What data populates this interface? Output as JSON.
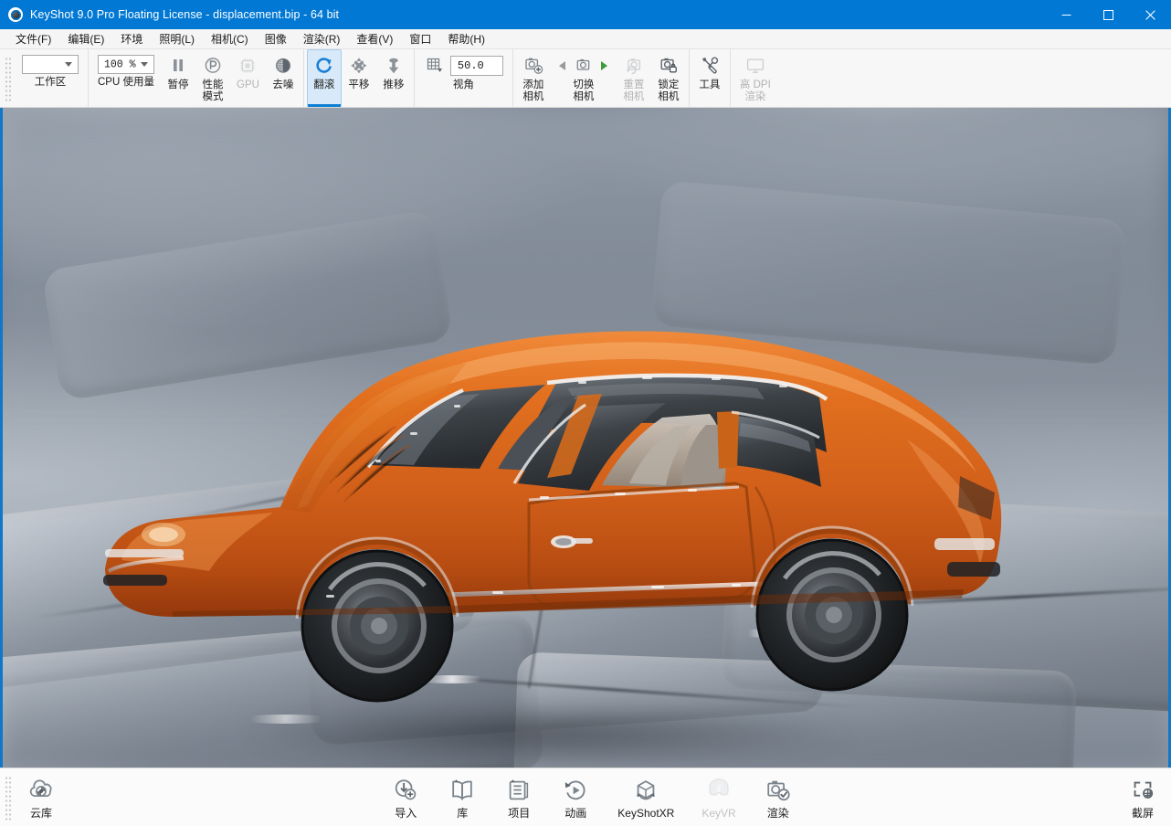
{
  "window": {
    "title": "KeyShot 9.0 Pro Floating License  - displacement.bip  - 64 bit",
    "app_name": "KeyShot 9.0 Pro Floating License",
    "document": "displacement.bip",
    "architecture": "64 bit",
    "accent_color": "#0078d4",
    "controls": {
      "minimize": "minimize-icon",
      "maximize": "maximize-icon",
      "close": "close-icon"
    }
  },
  "menubar": {
    "items": [
      {
        "label": "文件(F)"
      },
      {
        "label": "编辑(E)"
      },
      {
        "label": "环境"
      },
      {
        "label": "照明(L)"
      },
      {
        "label": "相机(C)"
      },
      {
        "label": "图像"
      },
      {
        "label": "渲染(R)"
      },
      {
        "label": "查看(V)"
      },
      {
        "label": "窗口"
      },
      {
        "label": "帮助(H)"
      }
    ]
  },
  "toolbar": {
    "workspace": {
      "label": "工作区",
      "value": "",
      "icon": "dropdown-combo"
    },
    "cpu_usage": {
      "label": "CPU 使用量",
      "value": "100 %",
      "icon": "dropdown-combo"
    },
    "pause": {
      "label": "暂停",
      "icon": "pause-icon",
      "enabled": true
    },
    "performance_mode": {
      "label": "性能\n模式",
      "icon": "performance-icon",
      "enabled": true
    },
    "gpu": {
      "label": "GPU",
      "icon": "gpu-chip-icon",
      "enabled": false
    },
    "denoise": {
      "label": "去噪",
      "icon": "denoise-icon",
      "enabled": true
    },
    "orbit": {
      "label": "翻滚",
      "icon": "orbit-icon",
      "enabled": true,
      "active": true
    },
    "pan": {
      "label": "平移",
      "icon": "pan-icon",
      "enabled": true,
      "active": false
    },
    "dolly": {
      "label": "推移",
      "icon": "dolly-icon",
      "enabled": true,
      "active": false
    },
    "fov": {
      "label": "视角",
      "value": "50.0",
      "icon": "perspective-grid-icon"
    },
    "add_camera": {
      "label": "添加\n相机",
      "icon": "camera-add-icon",
      "enabled": true
    },
    "switch_camera": {
      "label": "切换\n相机",
      "icon": "camera-switch-icon",
      "enabled": true,
      "prev_enabled": false,
      "next_enabled": true
    },
    "reset_camera": {
      "label": "重置\n相机",
      "icon": "camera-reset-icon",
      "enabled": false
    },
    "lock_camera": {
      "label": "锁定\n相机",
      "icon": "camera-lock-icon",
      "enabled": true
    },
    "tools": {
      "label": "工具",
      "icon": "tools-icon",
      "enabled": true
    },
    "high_dpi": {
      "label": "高 DPI\n渲染",
      "icon": "monitor-icon",
      "enabled": false
    }
  },
  "viewport": {
    "scene_name": "displacement.bip",
    "description": "Orange toy sports car on displaced rock ground",
    "border_color": "#1277c7",
    "car_body_color": "#d9651f",
    "car_body_shadow_color": "#a8430d",
    "glass_color": "#3e4348",
    "tire_color": "#24262a",
    "ground_color": "#8892a0"
  },
  "bottombar": {
    "cloud_library": {
      "label": "云库",
      "icon": "cloud-library-icon",
      "enabled": true
    },
    "items": [
      {
        "label": "导入",
        "icon": "import-icon",
        "enabled": true
      },
      {
        "label": "库",
        "icon": "library-book-icon",
        "enabled": true
      },
      {
        "label": "项目",
        "icon": "project-icon",
        "enabled": true
      },
      {
        "label": "动画",
        "icon": "animation-icon",
        "enabled": true
      },
      {
        "label": "KeyShotXR",
        "icon": "keyshotxr-icon",
        "enabled": true
      },
      {
        "label": "KeyVR",
        "icon": "keyvr-icon",
        "enabled": false
      },
      {
        "label": "渲染",
        "icon": "render-camera-icon",
        "enabled": true
      }
    ],
    "screenshot": {
      "label": "截屏",
      "icon": "screenshot-icon",
      "enabled": true
    }
  }
}
